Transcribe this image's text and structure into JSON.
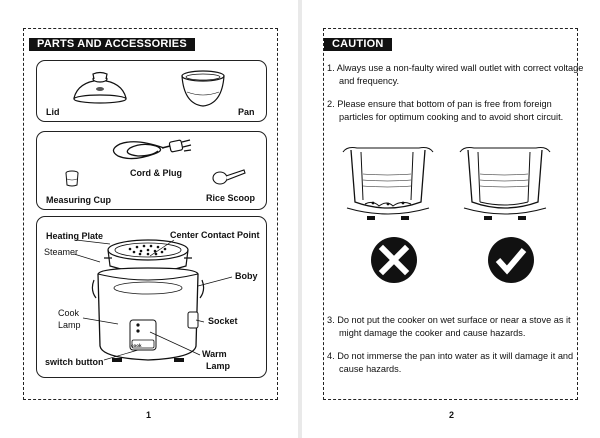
{
  "left_page": {
    "section_title": "PARTS AND ACCESSORIES",
    "box1": {
      "lid": "Lid",
      "pan": "Pan"
    },
    "box2": {
      "cord_plug": "Cord & Plug",
      "measuring_cup": "Measuring Cup",
      "rice_scoop": "Rice Scoop"
    },
    "box3": {
      "heating_plate": "Heating Plate",
      "center_contact_point": "Center Contact Point",
      "steamer": "Steamer",
      "boby": "Boby",
      "cook_lamp_1": "Cook",
      "cook_lamp_2": "Lamp",
      "socket": "Socket",
      "warm_lamp_1": "Warm",
      "warm_lamp_2": "Lamp",
      "switch_button": "switch button",
      "control_label": "cook"
    },
    "page_number": "1"
  },
  "right_page": {
    "section_title": "CAUTION",
    "items": [
      "1. Always use a non-faulty wired wall outlet with correct voltage and frequency.",
      "2. Please ensure that bottom of pan is free from foreign particles for optimum cooking and to avoid short circuit.",
      "3. Do not put the cooker on wet surface or near a stove as it might damage the cooker and cause hazards.",
      "4. Do not immerse the pan into water as it will damage it and cause hazards."
    ],
    "icons": [
      "cross-icon",
      "check-icon"
    ],
    "page_number": "2"
  }
}
